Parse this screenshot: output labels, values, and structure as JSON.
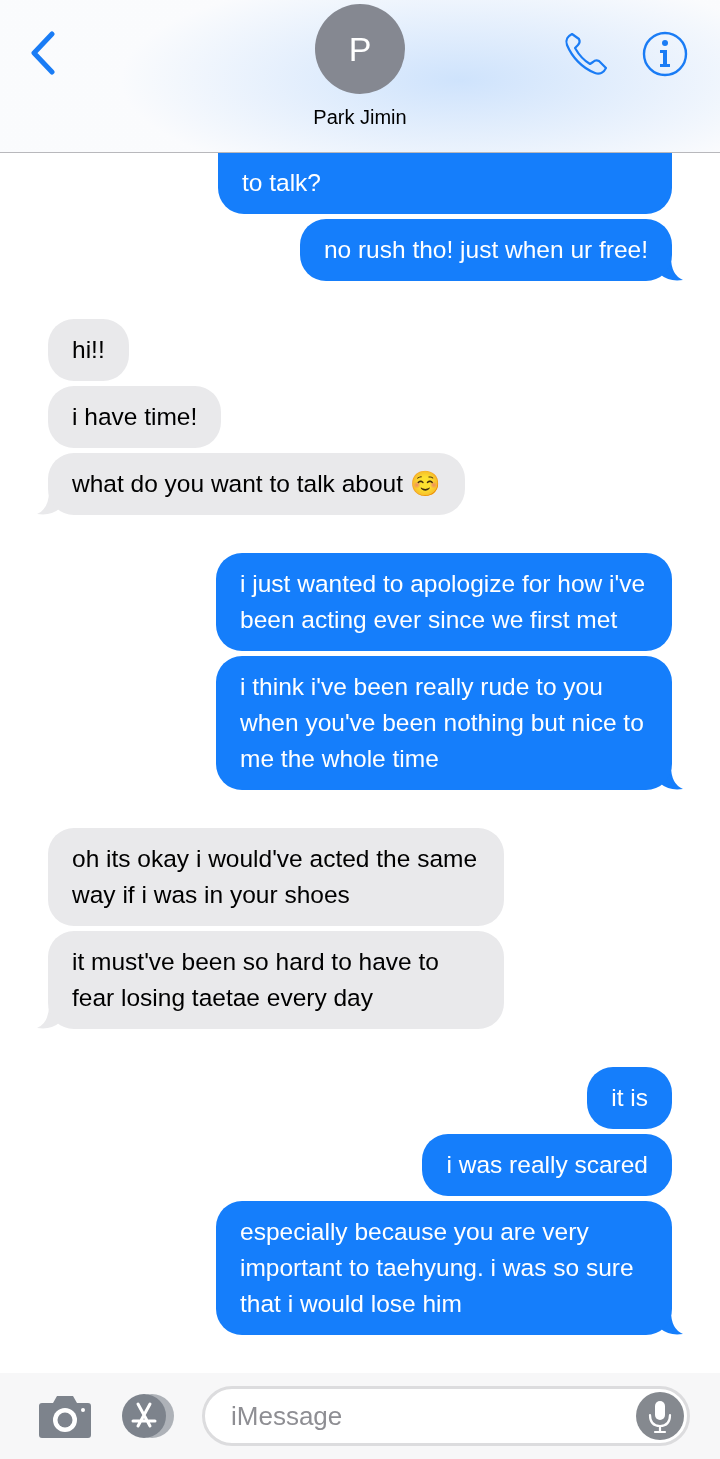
{
  "header": {
    "avatar_letter": "P",
    "contact_name": "Park Jimin"
  },
  "groups": [
    {
      "kind": "sent",
      "bubbles": [
        {
          "text": "to talk?",
          "clipped": true
        },
        {
          "text": "no rush tho! just when ur free!",
          "clipped": false
        }
      ]
    },
    {
      "kind": "received",
      "bubbles": [
        {
          "text": "hi!!",
          "clipped": false
        },
        {
          "text": "i have time!",
          "clipped": false
        },
        {
          "text": "what do you want to talk about ☺️",
          "clipped": false
        }
      ]
    },
    {
      "kind": "sent",
      "bubbles": [
        {
          "text": "i just wanted to apologize for how i've been acting ever since we first met",
          "clipped": false
        },
        {
          "text": "i think i've been really rude to you when you've been nothing but nice to me the whole time",
          "clipped": false
        }
      ]
    },
    {
      "kind": "received",
      "bubbles": [
        {
          "text": "oh its okay i would've acted the same way if i was in your shoes",
          "clipped": false
        },
        {
          "text": "it must've been so hard to have to fear losing taetae every day",
          "clipped": false
        }
      ]
    },
    {
      "kind": "sent",
      "bubbles": [
        {
          "text": "it is",
          "clipped": false
        },
        {
          "text": "i was really scared",
          "clipped": false
        },
        {
          "text": "especially because you are very important to taehyung. i was so sure that i would lose him",
          "clipped": false
        }
      ]
    }
  ],
  "composer": {
    "placeholder": "iMessage"
  }
}
